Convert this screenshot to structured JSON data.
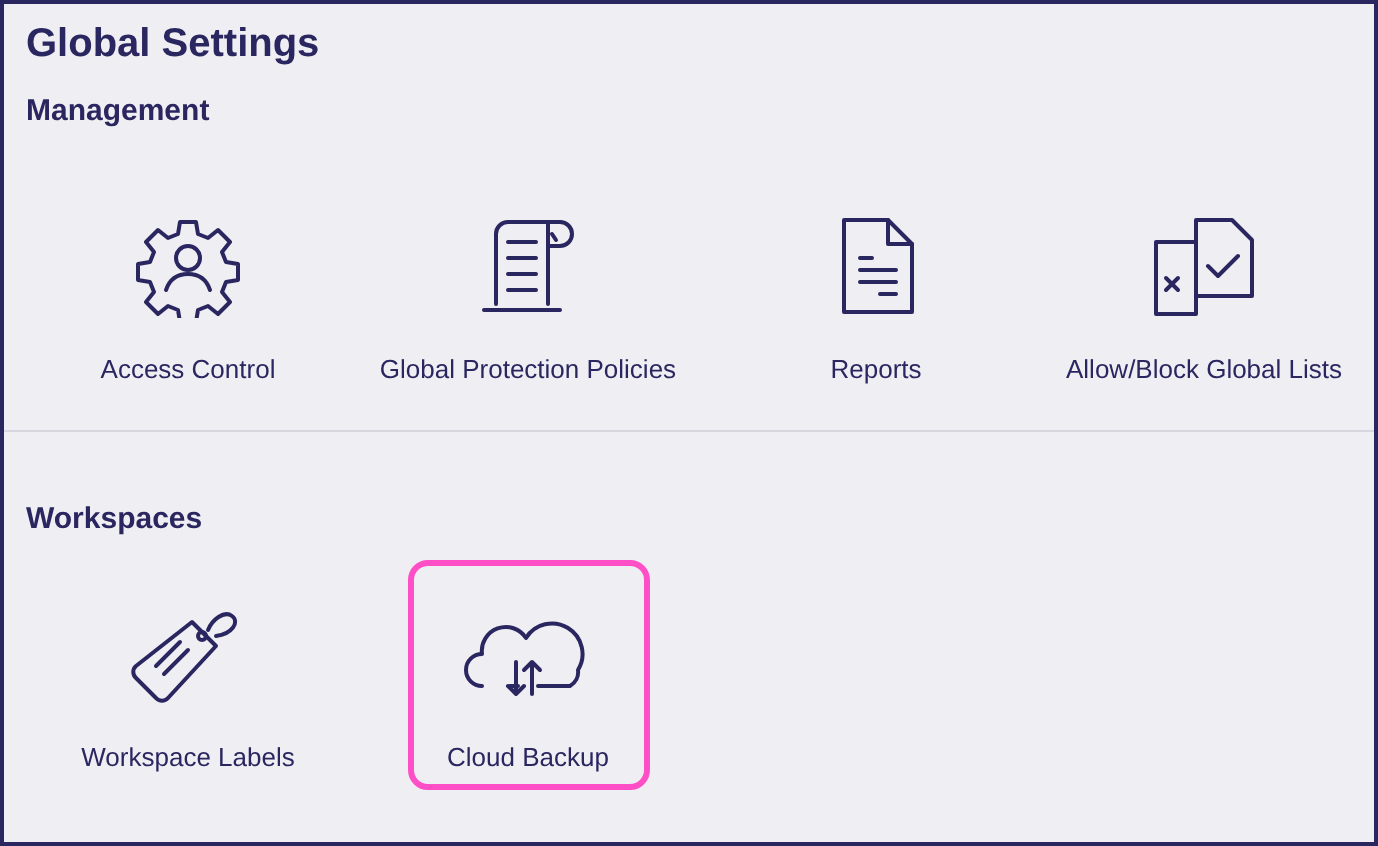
{
  "title": "Global Settings",
  "sections": [
    {
      "heading": "Management",
      "tiles": [
        {
          "label": "Access Control",
          "selected": false
        },
        {
          "label": "Global Protection Policies",
          "selected": false
        },
        {
          "label": "Reports",
          "selected": false
        },
        {
          "label": "Allow/Block Global Lists",
          "selected": false
        }
      ]
    },
    {
      "heading": "Workspaces",
      "tiles": [
        {
          "label": "Workspace Labels",
          "selected": false
        },
        {
          "label": "Cloud Backup",
          "selected": true
        }
      ]
    }
  ]
}
